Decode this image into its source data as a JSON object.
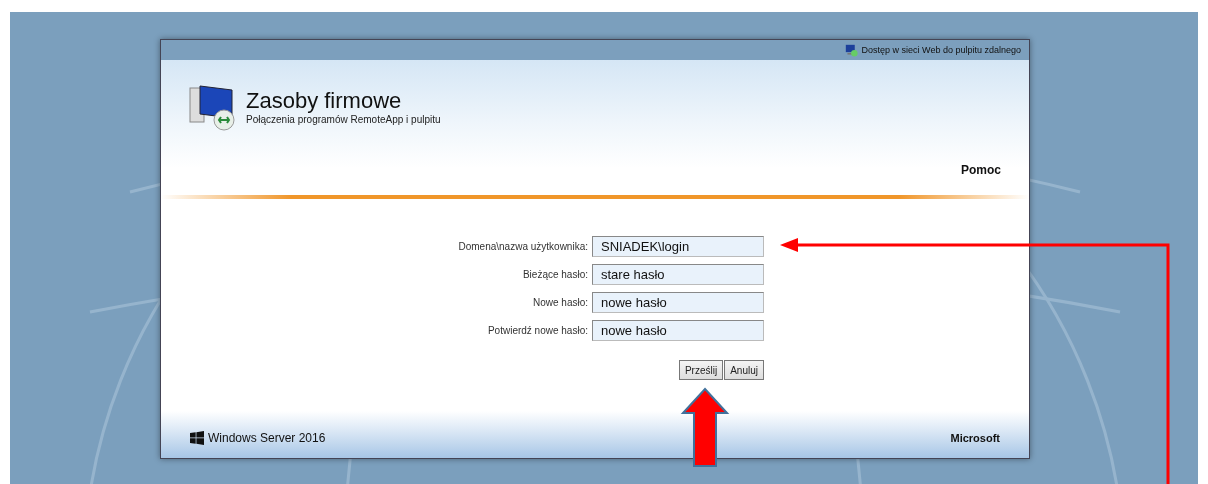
{
  "top_bar": {
    "link": "Dostęp w sieci Web do pulpitu zdalnego"
  },
  "header": {
    "title": "Zasoby firmowe",
    "subtitle": "Połączenia programów RemoteApp i pulpitu",
    "help": "Pomoc"
  },
  "form": {
    "fields": [
      {
        "label": "Domena\\nazwa użytkownika:",
        "value": "SNIADEK\\login"
      },
      {
        "label": "Bieżące hasło:",
        "value": "stare hasło"
      },
      {
        "label": "Nowe hasło:",
        "value": "nowe hasło"
      },
      {
        "label": "Potwierdź nowe hasło:",
        "value": "nowe hasło"
      }
    ],
    "buttons": [
      "Prześlij",
      "Anuluj"
    ]
  },
  "footer": {
    "product": "Windows Server 2016",
    "vendor": "Microsoft"
  }
}
